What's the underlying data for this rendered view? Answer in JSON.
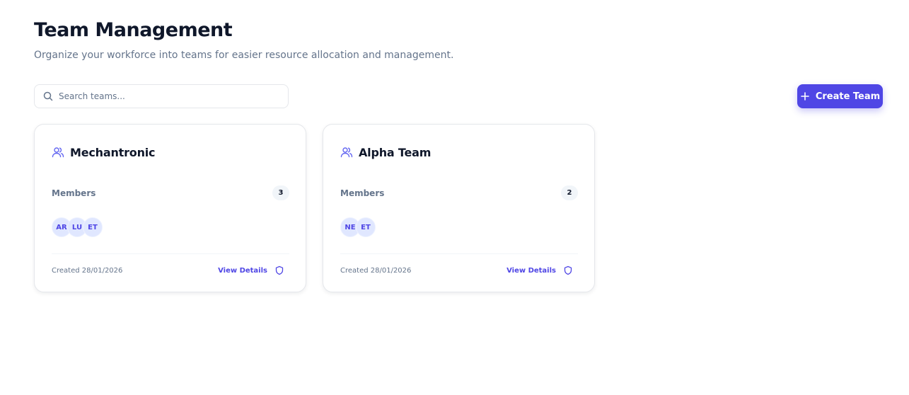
{
  "header": {
    "title": "Team Management",
    "subtitle": "Organize your workforce into teams for easier resource allocation and management."
  },
  "toolbar": {
    "search_placeholder": "Search teams...",
    "search_icon": "search-icon",
    "create_label": "Create Team",
    "create_icon": "plus-icon"
  },
  "colors": {
    "accent": "#4f46e5",
    "avatar_bg": "#e0e7ff",
    "muted_text": "#64748b",
    "title_text": "#0f172a"
  },
  "teams": [
    {
      "name": "Mechantronic",
      "icon": "users-icon",
      "members_label": "Members",
      "member_count": "3",
      "members": [
        "AR",
        "LU",
        "ET"
      ],
      "created": "Created 28/01/2026",
      "view_label": "View Details",
      "view_icon": "shield-icon"
    },
    {
      "name": "Alpha Team",
      "icon": "users-icon",
      "members_label": "Members",
      "member_count": "2",
      "members": [
        "NE",
        "ET"
      ],
      "created": "Created 28/01/2026",
      "view_label": "View Details",
      "view_icon": "shield-icon"
    }
  ]
}
